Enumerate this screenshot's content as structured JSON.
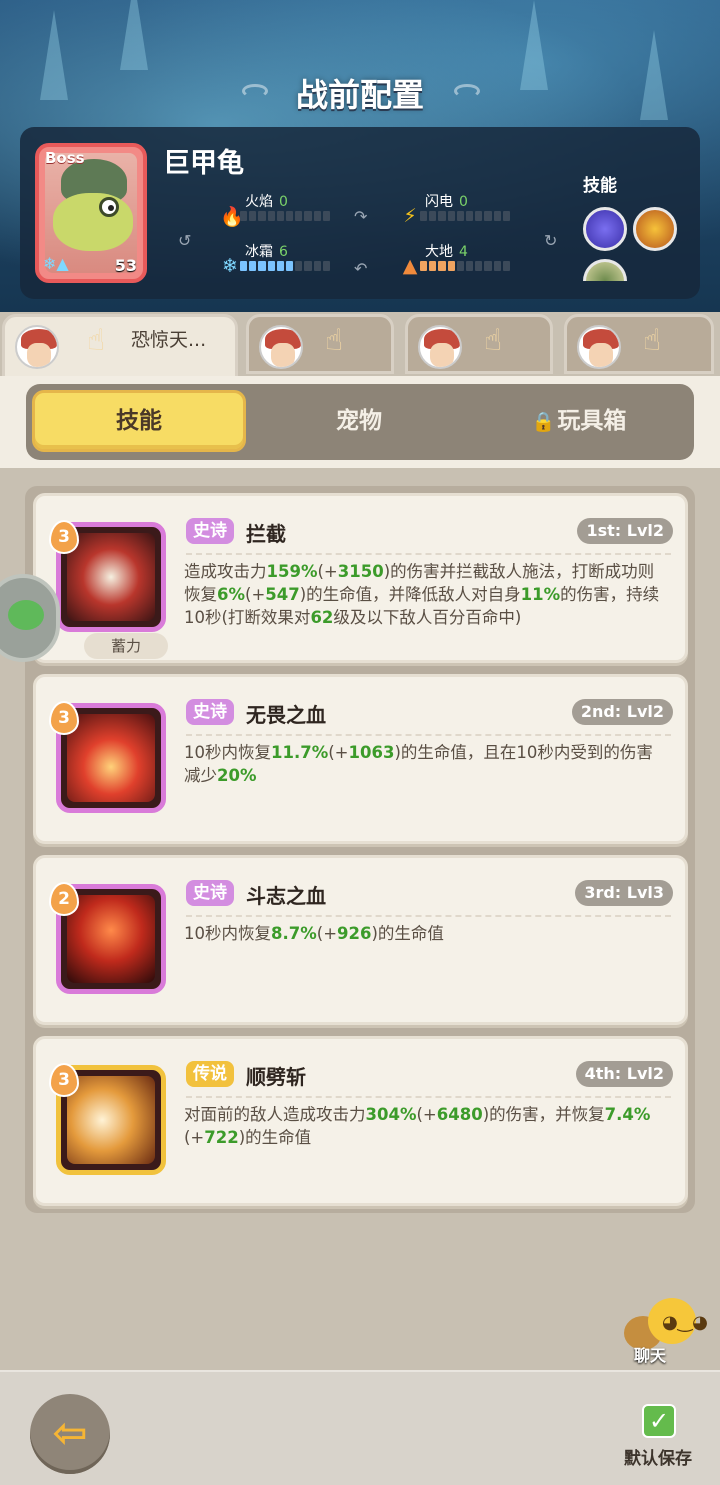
{
  "header": {
    "title": "战前配置"
  },
  "boss": {
    "badge": "Boss",
    "name": "巨甲龟",
    "level": "53",
    "elements": [
      {
        "label": "火焰",
        "value": "0",
        "icon": "fire-icon",
        "filled": 0
      },
      {
        "label": "闪电",
        "value": "0",
        "icon": "lightning-icon",
        "filled": 0
      },
      {
        "label": "冰霜",
        "value": "6",
        "icon": "frost-icon",
        "filled": 6
      },
      {
        "label": "大地",
        "value": "4",
        "icon": "earth-icon",
        "filled": 4
      }
    ],
    "skills_label": "技能"
  },
  "hero_tabs": [
    {
      "label": "恐惊天...",
      "active": true
    },
    {
      "label": "",
      "active": false
    },
    {
      "label": "",
      "active": false
    },
    {
      "label": "",
      "active": false
    }
  ],
  "tabs": [
    {
      "label": "技能",
      "active": true
    },
    {
      "label": "宠物",
      "active": false
    },
    {
      "label": "玩具箱",
      "active": false,
      "locked": true
    }
  ],
  "skills": [
    {
      "rank": "3",
      "rarity": "史诗",
      "name": "拦截",
      "slot": "1st: Lvl2",
      "desc_parts": [
        "造成攻击力",
        "159%",
        "(+",
        "3150",
        ")的伤害并拦截敌人施法，打断成功则恢复",
        "6%",
        "(+",
        "547",
        ")的生命值，并降低敌人对自身",
        "11%",
        "的伤害，持续10秒(打断效果对",
        "62",
        "级及以下敌人百分百命中)"
      ],
      "extra": "蓄力"
    },
    {
      "rank": "3",
      "rarity": "史诗",
      "name": "无畏之血",
      "slot": "2nd: Lvl2",
      "desc_parts": [
        "10秒内恢复",
        "11.7%",
        "(+",
        "1063",
        ")的生命值，且在10秒内受到的伤害减少",
        "20%"
      ]
    },
    {
      "rank": "2",
      "rarity": "史诗",
      "name": "斗志之血",
      "slot": "3rd: Lvl3",
      "desc_parts": [
        "10秒内恢复",
        "8.7%",
        "(+",
        "926",
        ")的生命值"
      ]
    },
    {
      "rank": "3",
      "rarity": "传说",
      "name": "顺劈斩",
      "slot": "4th: Lvl2",
      "desc_parts": [
        "对面前的敌人造成攻击力",
        "304%",
        "(+",
        "6480",
        ")的伤害，并恢复",
        "7.4%",
        "(+",
        "722",
        ")的生命值"
      ]
    }
  ],
  "chat": {
    "label": "聊天"
  },
  "footer": {
    "back_icon": "back-arrow-icon",
    "save_label": "默认保存"
  },
  "colors": {
    "highlight": "#3c9b2a",
    "epic": "#d38de0",
    "legend": "#f2c13d",
    "tab_active": "#f7dc64"
  }
}
